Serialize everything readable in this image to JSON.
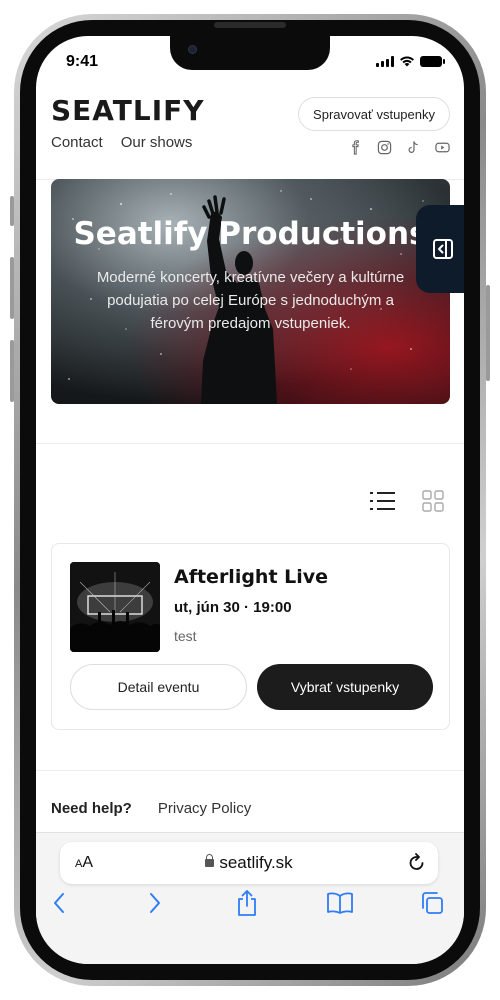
{
  "status": {
    "time": "9:41"
  },
  "header": {
    "logo": "SEATLIFY",
    "nav": [
      "Contact",
      "Our shows"
    ],
    "manage_button": "Spravovať vstupenky",
    "socials": [
      "facebook-icon",
      "instagram-icon",
      "tiktok-icon",
      "youtube-icon"
    ]
  },
  "hero": {
    "title": "Seatlify Productions",
    "description": "Moderné koncerty, kreatívne večery a kultúrne podujatia po celej Európe s jednoduchým a férovým predajom vstupeniek."
  },
  "view_toggle": [
    "list-view-icon",
    "grid-view-icon"
  ],
  "event": {
    "title": "Afterlight Live",
    "date": "ut, jún 30 · 19:00",
    "description": "test",
    "detail_button": "Detail eventu",
    "tickets_button": "Vybrať vstupenky"
  },
  "footer": {
    "help": "Need help?",
    "privacy": "Privacy Policy"
  },
  "browser": {
    "aa_small": "A",
    "aa_large": "A",
    "url": "seatlify.sk"
  },
  "colors": {
    "dark_tab": "#0e1b2b",
    "primary_button": "#1c1c1c",
    "browser_accent": "#2f7cf6"
  }
}
